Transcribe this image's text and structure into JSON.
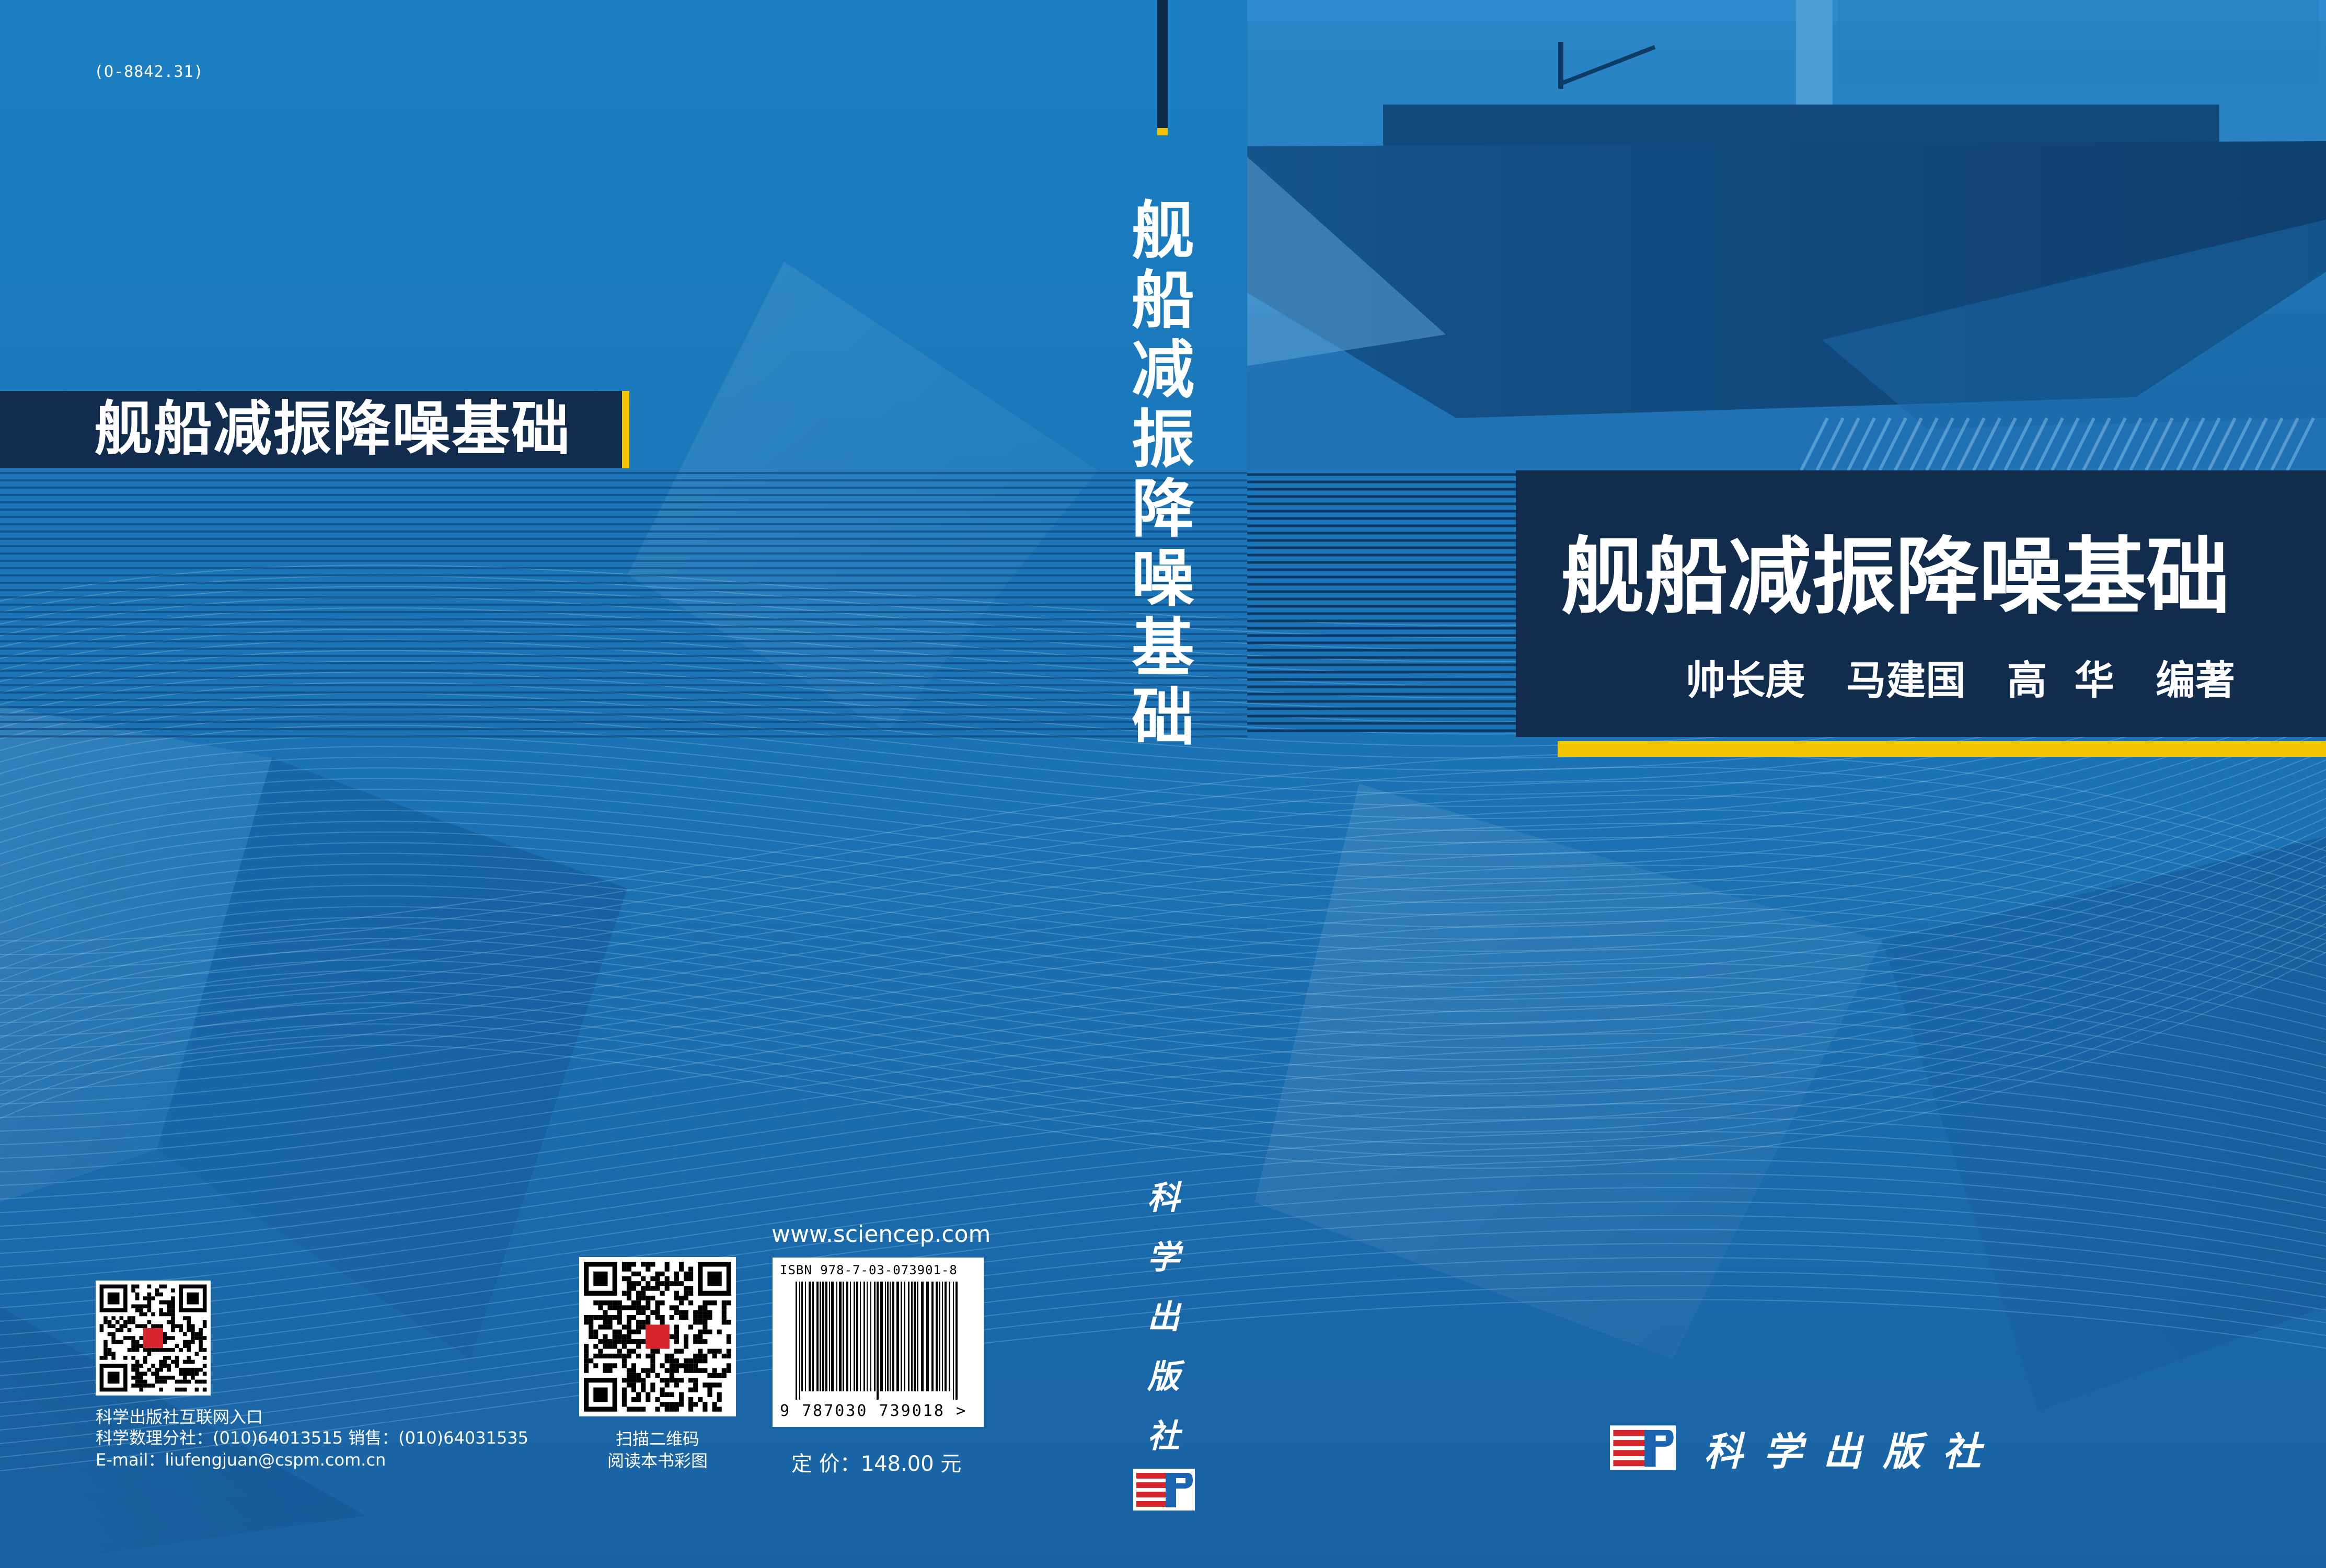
{
  "colors": {
    "cover_blue": "#1a74b8",
    "band_navy": "#112c4d",
    "accent_gold": "#f5c400",
    "logo_red": "#d6262b",
    "logo_blue": "#1a64b0"
  },
  "back_cover": {
    "classification_code": "(O-8842.31)",
    "title": "舰船减振降噪基础",
    "portal_label": "科学出版社互联网入口",
    "contact_line": "科学数理分社：(010)64013515   销售：(010)64031535",
    "email_line": "E-mail：liufengjuan@cspm.com.cn",
    "qr_caption_line1": "扫描二维码",
    "qr_caption_line2": "阅读本书彩图",
    "website": "www.sciencep.com",
    "isbn_text": "ISBN 978-7-03-073901-8",
    "isbn_digits": "9 787030 739018 >",
    "price": "定 价：148.00 元",
    "icons": [
      "qr-code-icon",
      "qr-code-icon",
      "barcode-icon"
    ]
  },
  "spine": {
    "title": "舰船减振降噪基础",
    "publisher": "科学出版社",
    "icon": "science-press-logo-icon"
  },
  "front_cover": {
    "title": "舰船减振降噪基础",
    "authors": "帅长庚   马建国   高  华   编著",
    "publisher": "科学出版社",
    "icon": "science-press-logo-icon"
  }
}
